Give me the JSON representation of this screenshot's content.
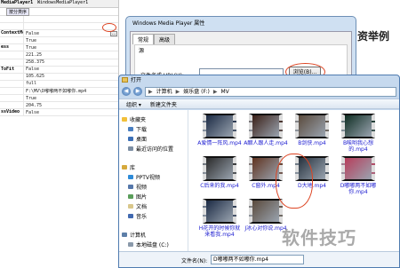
{
  "property_grid": {
    "header_name": "MediaPlayer1",
    "header_value": "WindowsMediaPlayer1",
    "tabs": [
      "",
      "按分类序"
    ],
    "rows": [
      {
        "key": "",
        "value": ""
      },
      {
        "key": "",
        "value": ""
      },
      {
        "key": "ContextMenu",
        "value": "False"
      },
      {
        "key": "",
        "value": "True"
      },
      {
        "key": "ess",
        "value": "True"
      },
      {
        "key": "",
        "value": "221.25"
      },
      {
        "key": "",
        "value": "258.375"
      },
      {
        "key": "ToFit",
        "value": "False"
      },
      {
        "key": "",
        "value": "105.625"
      },
      {
        "key": "",
        "value": "full"
      },
      {
        "key": "",
        "value": "F:\\MV\\D嘟嘟两不如嘟你.mp4"
      },
      {
        "key": "",
        "value": "True"
      },
      {
        "key": "",
        "value": "204.75"
      },
      {
        "key": "ssVideo",
        "value": "False"
      }
    ],
    "ellipsis_label": "..."
  },
  "wmp_dialog": {
    "title": "Windows Media Player 属性",
    "tabs": [
      "常规",
      "高级"
    ],
    "group_label": "源",
    "url_label": "文件名或 URL(U):",
    "url_value": "",
    "browse_label": "浏览(B)..."
  },
  "background_text": "资举例",
  "open_dialog": {
    "title": "打开",
    "back": "◀",
    "forward": "▶",
    "breadcrumb": [
      "▶",
      "计算机",
      "▶",
      "娱乐盘 (F:)",
      "▶",
      "MV"
    ],
    "toolbar": [
      "组织 ▾",
      "新建文件夹"
    ],
    "nav": {
      "favorites": "收藏夹",
      "favorites_items": [
        "下载",
        "桌面",
        "最近访问的位置"
      ],
      "library": "库",
      "library_items": [
        "PPTV视频",
        "视频",
        "图片",
        "文档",
        "音乐"
      ],
      "computer": "计算机",
      "computer_items": [
        "本地磁盘 (C:)"
      ]
    },
    "files": [
      {
        "name": "A爱情一阵风.mp4",
        "color": "#1b2a44"
      },
      {
        "name": "A醋人跟人走.mp4",
        "color": "#3a1f16"
      },
      {
        "name": "B剑侠.mp4",
        "color": "#5a4a3c"
      },
      {
        "name": "B唉哟我心想的.mp4",
        "color": "#0e2d22"
      },
      {
        "name": "C后来的我.mp4",
        "color": "#2a2a2a"
      },
      {
        "name": "C窗外.mp4",
        "color": "#60331f"
      },
      {
        "name": "D大地.mp4",
        "color": "#26313d"
      },
      {
        "name": "D嘟嘟两不如嘟你.mp4",
        "color": "#b73d5b"
      },
      {
        "name": "H花开的时候你就来看我.mp4",
        "color": "#1b2a44"
      },
      {
        "name": "J冰心对你说.mp4",
        "color": "#5a4a3c"
      }
    ],
    "filename_label": "文件名(N):",
    "filename_value": "D嘟嘟两不如嘟你.mp4"
  },
  "watermark": "软件技巧"
}
